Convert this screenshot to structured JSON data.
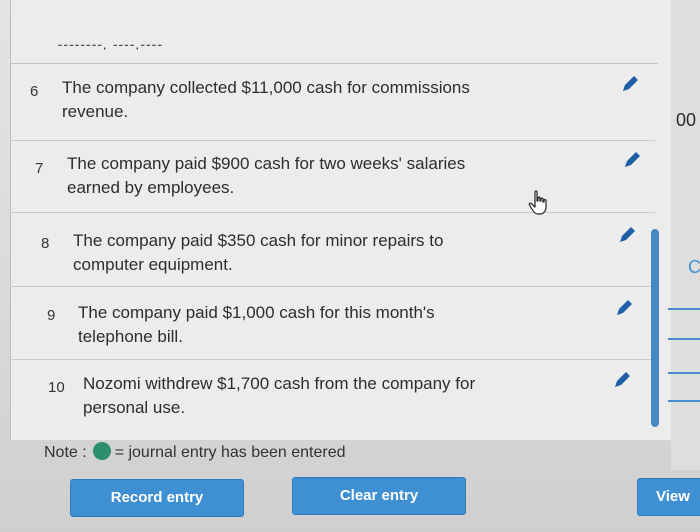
{
  "top_partial_text": "--------,  ----,----",
  "entries": [
    {
      "number": "6",
      "description": "The company collected $11,000 cash for commissions\nrevenue."
    },
    {
      "number": "7",
      "description": "The company paid $900 cash for two weeks' salaries\nearned by employees."
    },
    {
      "number": "8",
      "description": "The company paid $350 cash for minor repairs to\ncomputer equipment."
    },
    {
      "number": "9",
      "description": "The company paid $1,000 cash for this month's\ntelephone bill."
    },
    {
      "number": "10",
      "description": "Nozomi withdrew $1,700 cash from the company for\npersonal use."
    }
  ],
  "note": {
    "prefix": "Note :",
    "suffix": "= journal entry has been entered"
  },
  "buttons": {
    "record": "Record entry",
    "clear": "Clear entry",
    "view": "View"
  },
  "right_panel": {
    "text1": "00",
    "text2": "C"
  },
  "icons": {
    "edit": "pencil-icon",
    "pointer": "hand-pointer-icon",
    "entered_indicator": "green-dot-icon"
  },
  "colors": {
    "accent": "#3f90d3",
    "pencil": "#1e5fa8",
    "entered_dot": "#2e8f6e"
  }
}
